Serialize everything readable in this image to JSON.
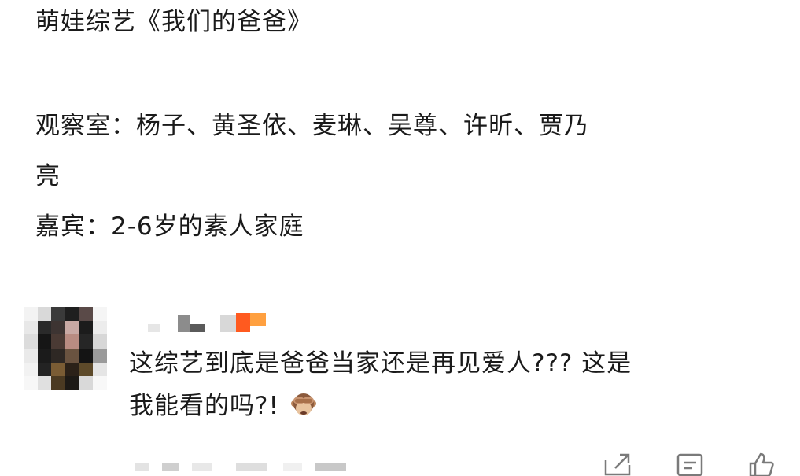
{
  "post": {
    "line1": "萌娃综艺《我们的爸爸》",
    "line2": "观察室：杨子、黄圣依、麦琳、吴尊、许昕、贾乃",
    "line3": "亮",
    "line4": "嘉宾：2-6岁的素人家庭"
  },
  "comment": {
    "text_line1": "这综艺到底是爸爸当家还是再见爱人???  这是",
    "text_line2": "我能看的吗?!",
    "emoji": "see-no-evil-monkey",
    "username_blurred": true,
    "avatar_blurred": true
  },
  "actions": {
    "icons": [
      "share-icon",
      "comment-icon",
      "like-icon"
    ]
  },
  "colors": {
    "text": "#1a1a1a",
    "icon": "#777777",
    "username_accent": "#ff7a2a"
  }
}
